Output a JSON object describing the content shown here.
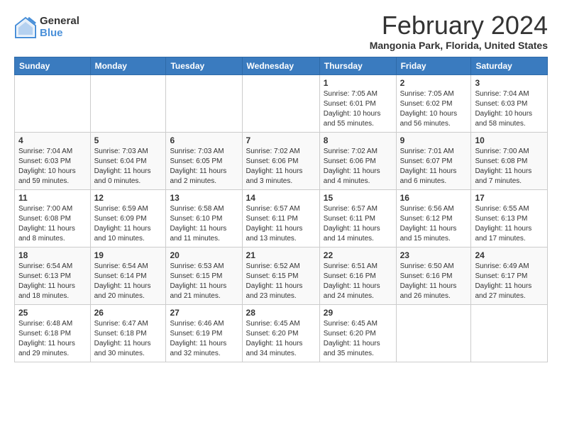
{
  "header": {
    "logo_general": "General",
    "logo_blue": "Blue",
    "month_title": "February 2024",
    "location": "Mangonia Park, Florida, United States"
  },
  "columns": [
    "Sunday",
    "Monday",
    "Tuesday",
    "Wednesday",
    "Thursday",
    "Friday",
    "Saturday"
  ],
  "weeks": [
    {
      "days": [
        {
          "number": "",
          "info": ""
        },
        {
          "number": "",
          "info": ""
        },
        {
          "number": "",
          "info": ""
        },
        {
          "number": "",
          "info": ""
        },
        {
          "number": "1",
          "info": "Sunrise: 7:05 AM\nSunset: 6:01 PM\nDaylight: 10 hours\nand 55 minutes."
        },
        {
          "number": "2",
          "info": "Sunrise: 7:05 AM\nSunset: 6:02 PM\nDaylight: 10 hours\nand 56 minutes."
        },
        {
          "number": "3",
          "info": "Sunrise: 7:04 AM\nSunset: 6:03 PM\nDaylight: 10 hours\nand 58 minutes."
        }
      ]
    },
    {
      "days": [
        {
          "number": "4",
          "info": "Sunrise: 7:04 AM\nSunset: 6:03 PM\nDaylight: 10 hours\nand 59 minutes."
        },
        {
          "number": "5",
          "info": "Sunrise: 7:03 AM\nSunset: 6:04 PM\nDaylight: 11 hours\nand 0 minutes."
        },
        {
          "number": "6",
          "info": "Sunrise: 7:03 AM\nSunset: 6:05 PM\nDaylight: 11 hours\nand 2 minutes."
        },
        {
          "number": "7",
          "info": "Sunrise: 7:02 AM\nSunset: 6:06 PM\nDaylight: 11 hours\nand 3 minutes."
        },
        {
          "number": "8",
          "info": "Sunrise: 7:02 AM\nSunset: 6:06 PM\nDaylight: 11 hours\nand 4 minutes."
        },
        {
          "number": "9",
          "info": "Sunrise: 7:01 AM\nSunset: 6:07 PM\nDaylight: 11 hours\nand 6 minutes."
        },
        {
          "number": "10",
          "info": "Sunrise: 7:00 AM\nSunset: 6:08 PM\nDaylight: 11 hours\nand 7 minutes."
        }
      ]
    },
    {
      "days": [
        {
          "number": "11",
          "info": "Sunrise: 7:00 AM\nSunset: 6:08 PM\nDaylight: 11 hours\nand 8 minutes."
        },
        {
          "number": "12",
          "info": "Sunrise: 6:59 AM\nSunset: 6:09 PM\nDaylight: 11 hours\nand 10 minutes."
        },
        {
          "number": "13",
          "info": "Sunrise: 6:58 AM\nSunset: 6:10 PM\nDaylight: 11 hours\nand 11 minutes."
        },
        {
          "number": "14",
          "info": "Sunrise: 6:57 AM\nSunset: 6:11 PM\nDaylight: 11 hours\nand 13 minutes."
        },
        {
          "number": "15",
          "info": "Sunrise: 6:57 AM\nSunset: 6:11 PM\nDaylight: 11 hours\nand 14 minutes."
        },
        {
          "number": "16",
          "info": "Sunrise: 6:56 AM\nSunset: 6:12 PM\nDaylight: 11 hours\nand 15 minutes."
        },
        {
          "number": "17",
          "info": "Sunrise: 6:55 AM\nSunset: 6:13 PM\nDaylight: 11 hours\nand 17 minutes."
        }
      ]
    },
    {
      "days": [
        {
          "number": "18",
          "info": "Sunrise: 6:54 AM\nSunset: 6:13 PM\nDaylight: 11 hours\nand 18 minutes."
        },
        {
          "number": "19",
          "info": "Sunrise: 6:54 AM\nSunset: 6:14 PM\nDaylight: 11 hours\nand 20 minutes."
        },
        {
          "number": "20",
          "info": "Sunrise: 6:53 AM\nSunset: 6:15 PM\nDaylight: 11 hours\nand 21 minutes."
        },
        {
          "number": "21",
          "info": "Sunrise: 6:52 AM\nSunset: 6:15 PM\nDaylight: 11 hours\nand 23 minutes."
        },
        {
          "number": "22",
          "info": "Sunrise: 6:51 AM\nSunset: 6:16 PM\nDaylight: 11 hours\nand 24 minutes."
        },
        {
          "number": "23",
          "info": "Sunrise: 6:50 AM\nSunset: 6:16 PM\nDaylight: 11 hours\nand 26 minutes."
        },
        {
          "number": "24",
          "info": "Sunrise: 6:49 AM\nSunset: 6:17 PM\nDaylight: 11 hours\nand 27 minutes."
        }
      ]
    },
    {
      "days": [
        {
          "number": "25",
          "info": "Sunrise: 6:48 AM\nSunset: 6:18 PM\nDaylight: 11 hours\nand 29 minutes."
        },
        {
          "number": "26",
          "info": "Sunrise: 6:47 AM\nSunset: 6:18 PM\nDaylight: 11 hours\nand 30 minutes."
        },
        {
          "number": "27",
          "info": "Sunrise: 6:46 AM\nSunset: 6:19 PM\nDaylight: 11 hours\nand 32 minutes."
        },
        {
          "number": "28",
          "info": "Sunrise: 6:45 AM\nSunset: 6:20 PM\nDaylight: 11 hours\nand 34 minutes."
        },
        {
          "number": "29",
          "info": "Sunrise: 6:45 AM\nSunset: 6:20 PM\nDaylight: 11 hours\nand 35 minutes."
        },
        {
          "number": "",
          "info": ""
        },
        {
          "number": "",
          "info": ""
        }
      ]
    }
  ]
}
